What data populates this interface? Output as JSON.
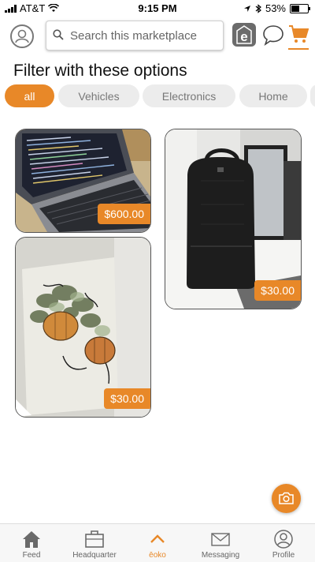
{
  "status_bar": {
    "carrier": "AT&T",
    "time": "9:15 PM",
    "battery": "53%"
  },
  "header": {
    "search_placeholder": "Search this marketplace"
  },
  "filter": {
    "title": "Filter with these options",
    "chips": [
      "all",
      "Vehicles",
      "Electronics",
      "Home"
    ],
    "active": "all"
  },
  "listings": [
    {
      "price": "$600.00",
      "image": "laptop-photo"
    },
    {
      "price": "$30.00",
      "image": "backpack-photo"
    },
    {
      "price": "$30.00",
      "image": "pumpkin-painting-photo"
    }
  ],
  "nav": [
    {
      "label": "Feed",
      "icon": "home-icon"
    },
    {
      "label": "Headquarter",
      "icon": "briefcase-icon"
    },
    {
      "label": "ēoko",
      "icon": "chevron-up-icon"
    },
    {
      "label": "Messaging",
      "icon": "envelope-icon"
    },
    {
      "label": "Profile",
      "icon": "user-icon"
    }
  ],
  "colors": {
    "accent": "#e88828",
    "chip_bg": "#ececec"
  }
}
